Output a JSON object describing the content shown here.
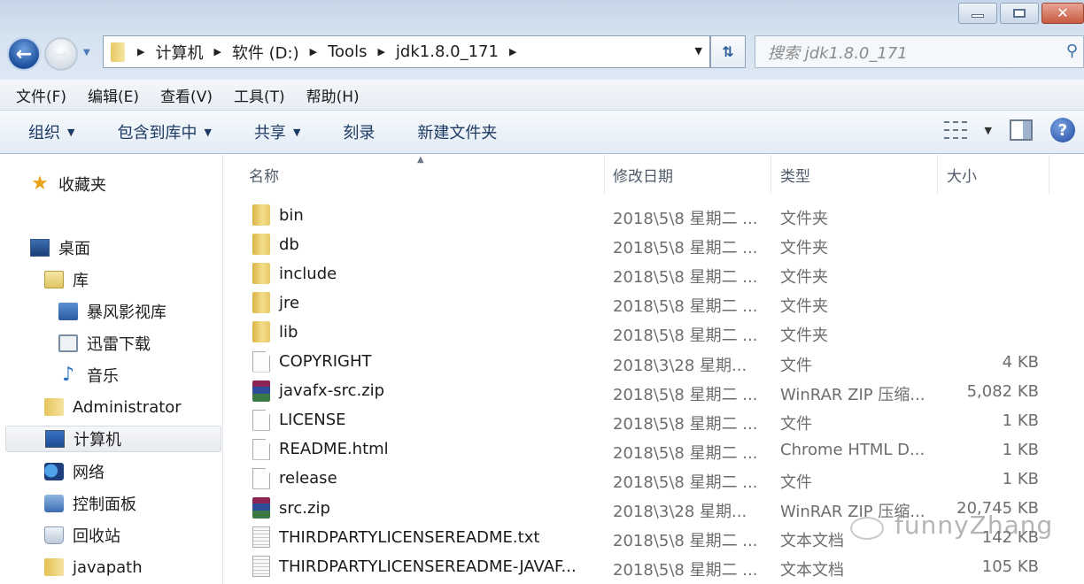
{
  "window": {
    "controls": {
      "minimize": "minimize",
      "maximize": "maximize",
      "close": "close"
    }
  },
  "navigation": {
    "back_icon": "back-arrow-icon",
    "forward_icon": "forward-arrow-icon",
    "breadcrumbs": [
      "计算机",
      "软件 (D:)",
      "Tools",
      "jdk1.8.0_171"
    ],
    "search_placeholder": "搜索 jdk1.8.0_171"
  },
  "menubar": {
    "items": [
      "文件(F)",
      "编辑(E)",
      "查看(V)",
      "工具(T)",
      "帮助(H)"
    ]
  },
  "commandbar": {
    "items": [
      {
        "label": "组织",
        "dropdown": true
      },
      {
        "label": "包含到库中",
        "dropdown": true
      },
      {
        "label": "共享",
        "dropdown": true
      },
      {
        "label": "刻录",
        "dropdown": false
      },
      {
        "label": "新建文件夹",
        "dropdown": false
      }
    ]
  },
  "sidebar": {
    "items": [
      {
        "label": "收藏夹",
        "icon": "star-icon"
      },
      {
        "label": "桌面",
        "icon": "desktop-icon"
      },
      {
        "label": "库",
        "icon": "library-icon"
      },
      {
        "label": "暴风影视库",
        "icon": "video-library-icon"
      },
      {
        "label": "迅雷下载",
        "icon": "download-icon"
      },
      {
        "label": "音乐",
        "icon": "music-icon"
      },
      {
        "label": "Administrator",
        "icon": "user-folder-icon"
      },
      {
        "label": "计算机",
        "icon": "computer-icon",
        "selected": true
      },
      {
        "label": "网络",
        "icon": "network-icon"
      },
      {
        "label": "控制面板",
        "icon": "control-panel-icon"
      },
      {
        "label": "回收站",
        "icon": "recycle-bin-icon"
      },
      {
        "label": "javapath",
        "icon": "folder-icon"
      }
    ]
  },
  "filelist": {
    "columns": [
      "名称",
      "修改日期",
      "类型",
      "大小"
    ],
    "rows": [
      {
        "name": "bin",
        "date": "2018\\5\\8 星期二 ...",
        "type": "文件夹",
        "size": "",
        "icon": "folder"
      },
      {
        "name": "db",
        "date": "2018\\5\\8 星期二 ...",
        "type": "文件夹",
        "size": "",
        "icon": "folder"
      },
      {
        "name": "include",
        "date": "2018\\5\\8 星期二 ...",
        "type": "文件夹",
        "size": "",
        "icon": "folder"
      },
      {
        "name": "jre",
        "date": "2018\\5\\8 星期二 ...",
        "type": "文件夹",
        "size": "",
        "icon": "folder"
      },
      {
        "name": "lib",
        "date": "2018\\5\\8 星期二 ...",
        "type": "文件夹",
        "size": "",
        "icon": "folder"
      },
      {
        "name": "COPYRIGHT",
        "date": "2018\\3\\28 星期...",
        "type": "文件",
        "size": "4 KB",
        "icon": "file"
      },
      {
        "name": "javafx-src.zip",
        "date": "2018\\5\\8 星期二 ...",
        "type": "WinRAR ZIP 压缩...",
        "size": "5,082 KB",
        "icon": "zip"
      },
      {
        "name": "LICENSE",
        "date": "2018\\5\\8 星期二 ...",
        "type": "文件",
        "size": "1 KB",
        "icon": "file"
      },
      {
        "name": "README.html",
        "date": "2018\\5\\8 星期二 ...",
        "type": "Chrome HTML D...",
        "size": "1 KB",
        "icon": "file"
      },
      {
        "name": "release",
        "date": "2018\\5\\8 星期二 ...",
        "type": "文件",
        "size": "1 KB",
        "icon": "file"
      },
      {
        "name": "src.zip",
        "date": "2018\\3\\28 星期...",
        "type": "WinRAR ZIP 压缩...",
        "size": "20,745 KB",
        "icon": "zip"
      },
      {
        "name": "THIRDPARTYLICENSEREADME.txt",
        "date": "2018\\5\\8 星期二 ...",
        "type": "文本文档",
        "size": "142 KB",
        "icon": "txt"
      },
      {
        "name": "THIRDPARTYLICENSEREADME-JAVAF...",
        "date": "2018\\5\\8 星期二 ...",
        "type": "文本文档",
        "size": "105 KB",
        "icon": "txt"
      }
    ]
  },
  "watermark": "funnyZhang"
}
